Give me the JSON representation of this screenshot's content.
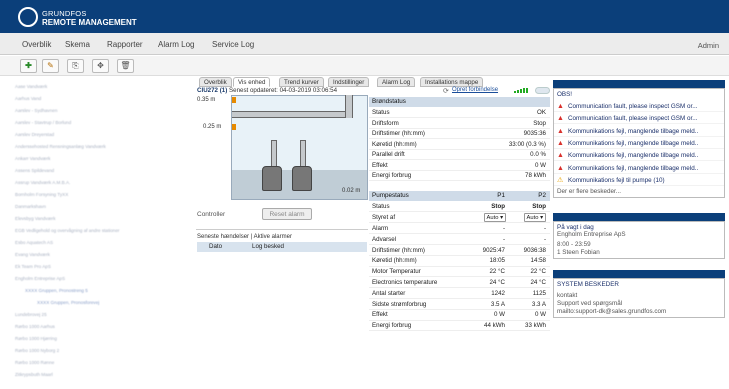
{
  "header": {
    "brand_line1": "GRUNDFOS",
    "brand_line2": "REMOTE MANAGEMENT"
  },
  "nav": {
    "items": [
      "Overblik",
      "Skema",
      "Rapporter",
      "Alarm Log",
      "Service Log"
    ],
    "user": "Admin"
  },
  "toolbar": {
    "buttons": [
      "add-icon",
      "edit-icon",
      "copy-icon",
      "move-icon",
      "delete-icon"
    ]
  },
  "tree": {
    "items": [
      "Aase Vandværk",
      "Aarhus Vand",
      "Aarslev - Sydhavnen",
      "Aarslev - Stavtrup / Borlund",
      "Aarslev Dreyerstad",
      "Anderssehosted Rensningsanlæg Vandværk",
      "Ankarr Vandværk",
      "Assens Spildevand",
      "Assrup Vandværk A.M.B.A.",
      "Bornholm Forsyning TyXX",
      "Danmarkshavn",
      "Elevsbyg Vandværk",
      "EGB Vedligehold og overvågning af andre stationer",
      "Esbo Aquatech AS",
      "Evang Vandværk",
      "Ek Team Pro ApS",
      "Engholm Entreprise ApS",
      "XXXX Gruppen, Pronostreng 5",
      "XXXX Gruppen, Pronosforevej",
      "Lundebrovej 25",
      "Rørbo 1000 Aarhus",
      "Rørbo 1000 Hjørring",
      "Rørbo 1000 Nyborg 2",
      "Rørbo 1000 Rønne",
      "Zitkrypsbuth Maarl"
    ]
  },
  "tabs": [
    "Overblik",
    "Vis enhed",
    "Trend kurver",
    "Indstillinger",
    "Alarm Log",
    "Installations mappe"
  ],
  "station": {
    "id": "CIU272 (1)",
    "updated": "Senest opdateret: 04-03-2019 03:06:54",
    "connect_link": "Opret forbindelse"
  },
  "tank": {
    "level_top": "0.35 m",
    "level_mid": "0.25 m",
    "level_bottom": "0.02 m"
  },
  "controller": {
    "label": "Controller",
    "reset_button": "Reset alarm"
  },
  "events": {
    "title": "Seneste hændelser | Aktive alarmer",
    "col_date": "Dato",
    "col_log": "Log besked"
  },
  "brondstatus": {
    "title": "Brøndstatus",
    "rows": [
      {
        "label": "Status",
        "value": "OK"
      },
      {
        "label": "Driftsform",
        "value": "Stop"
      },
      {
        "label": "Driftstimer (hh:mm)",
        "value": "9035:36"
      },
      {
        "label": "Køretid (hh:mm)",
        "value": "33:00 (0.3 %)"
      },
      {
        "label": "Parallel drift",
        "value": "0.0 %"
      },
      {
        "label": "Effekt",
        "value": "0 W"
      },
      {
        "label": "Energi forbrug",
        "value": "78 kWh"
      }
    ]
  },
  "pumpestatus": {
    "title": "Pumpestatus",
    "col1": "P1",
    "col2": "P2",
    "status": {
      "label": "Status",
      "p1": "Stop",
      "p2": "Stop"
    },
    "styret": {
      "label": "Styret af",
      "p1": "Auto ▾",
      "p2": "Auto ▾"
    },
    "rows": [
      {
        "label": "Alarm",
        "p1": "-",
        "p2": "-"
      },
      {
        "label": "Advarsel",
        "p1": "-",
        "p2": "-"
      },
      {
        "label": "Driftstimer (hh:mm)",
        "p1": "9025:47",
        "p2": "9036:38"
      },
      {
        "label": "Køretid (hh:mm)",
        "p1": "18:05",
        "p2": "14:58"
      },
      {
        "label": "Motor Temperatur",
        "p1": "22 °C",
        "p2": "22 °C"
      },
      {
        "label": "Electronics temperature",
        "p1": "24 °C",
        "p2": "24 °C"
      },
      {
        "label": "Antal starter",
        "p1": "1242",
        "p2": "1125"
      },
      {
        "label": "Sidste strømforbrug",
        "p1": "3.5 A",
        "p2": "3.3 A"
      },
      {
        "label": "Effekt",
        "p1": "0 W",
        "p2": "0 W"
      },
      {
        "label": "Energi forbrug",
        "p1": "44 kWh",
        "p2": "33 kWh"
      }
    ]
  },
  "obs": {
    "title": "OBS!",
    "alarms": [
      {
        "text": "Communication fault, please inspect GSM or...",
        "type": "alarm"
      },
      {
        "text": "Communication fault, please inspect GSM or...",
        "type": "alarm"
      },
      {
        "text": "Kommunikations fejl, manglende tilbage meld..",
        "type": "alarm"
      },
      {
        "text": "Kommunikations fejl, manglende tilbage meld..",
        "type": "alarm"
      },
      {
        "text": "Kommunikations fejl, manglende tilbage meld..",
        "type": "alarm"
      },
      {
        "text": "Kommunikations fejl, manglende tilbage meld..",
        "type": "alarm"
      },
      {
        "text": "Kommunikations fejl til pumpe (10)",
        "type": "warning"
      }
    ],
    "more": "Der er flere beskeder..."
  },
  "duty": {
    "title": "På vagt i dag",
    "company": "Engholm Entreprise ApS",
    "time": "8:00 - 23:59",
    "person": "1 Steen Fobian"
  },
  "system": {
    "title": "SYSTEM BESKEDER",
    "contact": "kontakt",
    "support": "Support ved spørgsmål",
    "mail": "mailto:support-dk@sales.grundfos.com"
  },
  "colors": {
    "header": "#0b3f7a",
    "section": "#cfdbe8",
    "alarm": "#d9302c",
    "warning": "#e8a200"
  }
}
